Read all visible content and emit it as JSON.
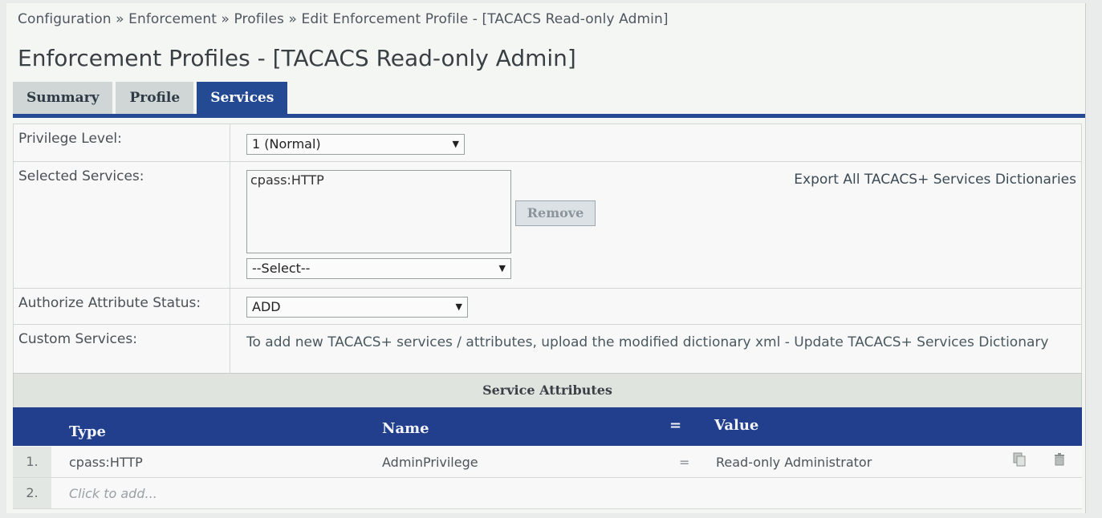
{
  "breadcrumb": "Configuration » Enforcement » Profiles » Edit Enforcement Profile - [TACACS Read-only Admin]",
  "page_title": "Enforcement Profiles - [TACACS Read-only Admin]",
  "tabs": [
    {
      "label": "Summary",
      "active": false
    },
    {
      "label": "Profile",
      "active": false
    },
    {
      "label": "Services",
      "active": true
    }
  ],
  "form": {
    "privilege_level": {
      "label": "Privilege Level:",
      "value": "1 (Normal)"
    },
    "selected_services": {
      "label": "Selected Services:",
      "items": [
        "cpass:HTTP"
      ],
      "remove_label": "Remove",
      "select_value": "--Select--",
      "export_link": "Export All TACACS+ Services Dictionaries"
    },
    "authorize_status": {
      "label": "Authorize Attribute Status:",
      "value": "ADD"
    },
    "custom_services": {
      "label": "Custom Services:",
      "text": "To add new TACACS+ services / attributes, upload the modified dictionary xml - Update TACACS+ Services Dictionary"
    }
  },
  "service_attributes": {
    "title": "Service Attributes",
    "columns": {
      "type": "Type",
      "name": "Name",
      "eq": "=",
      "value": "Value"
    },
    "rows": [
      {
        "num": "1.",
        "type": "cpass:HTTP",
        "name": "AdminPrivilege",
        "eq": "=",
        "value": "Read-only Administrator"
      },
      {
        "num": "2.",
        "placeholder": "Click to add..."
      }
    ]
  },
  "colors": {
    "accent": "#244a93",
    "header_bg": "#213f8d",
    "background": "#f4f6f4"
  },
  "icons": {
    "copy": "copy-icon",
    "delete": "trash-icon"
  }
}
